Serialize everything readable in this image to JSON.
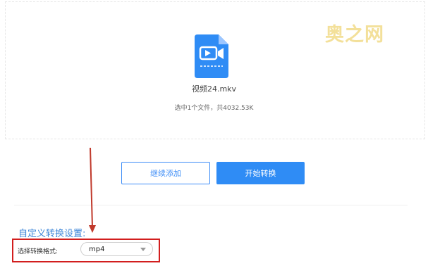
{
  "upload": {
    "file_name": "视频24.mkv",
    "summary": "选中1个文件，共4032.53K"
  },
  "watermark": {
    "text": "奥之网"
  },
  "buttons": {
    "continue_label": "继续添加",
    "start_label": "开始转换"
  },
  "settings": {
    "title": "自定义转换设置:",
    "format_label": "选择转换格式:",
    "format_value": "mp4"
  },
  "colors": {
    "accent": "#2f8cf5",
    "highlight_border": "#d21e1e",
    "arrow": "#c0392b"
  },
  "icons": {
    "file": "video-file-icon",
    "select_caret": "caret-down-icon",
    "annotation": "red-arrow-icon"
  }
}
